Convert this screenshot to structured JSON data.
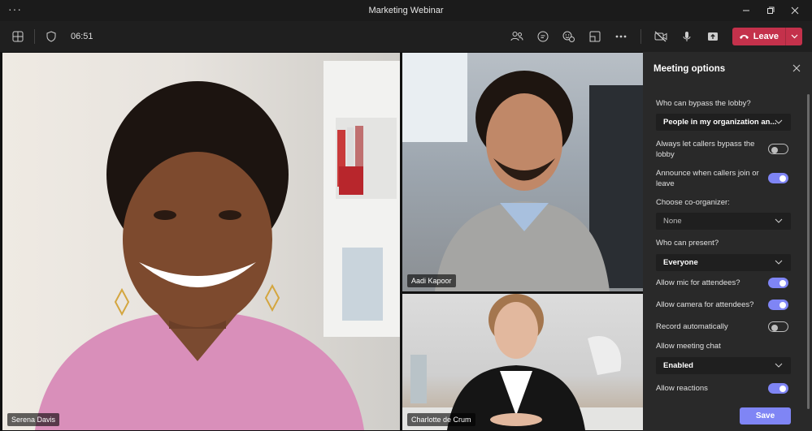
{
  "window": {
    "title": "Marketing Webinar",
    "menu_glyph": "···"
  },
  "toolbar": {
    "timer": "06:51",
    "leave_label": "Leave"
  },
  "participants": [
    {
      "name": "Serena Davis"
    },
    {
      "name": "Aadi Kapoor"
    },
    {
      "name": "Charlotte de Crum"
    }
  ],
  "panel": {
    "title": "Meeting options",
    "bypass_lobby": {
      "label": "Who can bypass the lobby?",
      "value": "People in my organization an..."
    },
    "callers_bypass": {
      "label": "Always let callers bypass the lobby",
      "on": false
    },
    "announce": {
      "label": "Announce when callers join or leave",
      "on": true
    },
    "coorganizer": {
      "label": "Choose co-organizer:",
      "value": "None"
    },
    "present": {
      "label": "Who can present?",
      "value": "Everyone"
    },
    "mic": {
      "label": "Allow mic for attendees?",
      "on": true
    },
    "camera": {
      "label": "Allow camera for attendees?",
      "on": true
    },
    "record": {
      "label": "Record automatically",
      "on": false
    },
    "chat": {
      "label": "Allow meeting chat",
      "value": "Enabled"
    },
    "reactions": {
      "label": "Allow reactions",
      "on": true
    },
    "save_label": "Save"
  },
  "colors": {
    "accent": "#7f85f5",
    "leave": "#c4314b",
    "panel_bg": "#292929"
  }
}
